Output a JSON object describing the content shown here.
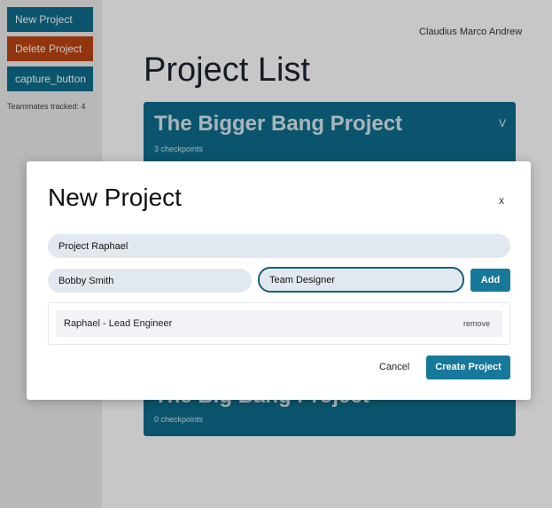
{
  "sidebar": {
    "new_project_label": "New Project",
    "delete_project_label": "Delete Project",
    "capture_label": "capture_button",
    "teammates_text": "Teammates tracked: 4"
  },
  "header": {
    "user_name": "Claudius Marco Andrew",
    "page_title": "Project List"
  },
  "projects": [
    {
      "title": "The Bigger Bang Project",
      "checkpoints": "3 checkpoints",
      "toggle": "V"
    },
    {
      "title": "The Big Bang Project",
      "checkpoints": "0 checkpoints"
    }
  ],
  "modal": {
    "title": "New Project",
    "close_label": "x",
    "project_name_value": "Project Raphael",
    "member_name_value": "Bobby Smith",
    "member_role_value": "Team Designer",
    "add_label": "Add",
    "members": [
      {
        "text": "Raphael - Lead Engineer",
        "remove_label": "remove"
      }
    ],
    "cancel_label": "Cancel",
    "create_label": "Create Project"
  },
  "colors": {
    "primary": "#0e6e8c",
    "danger": "#bb4512",
    "button": "#16789a"
  }
}
